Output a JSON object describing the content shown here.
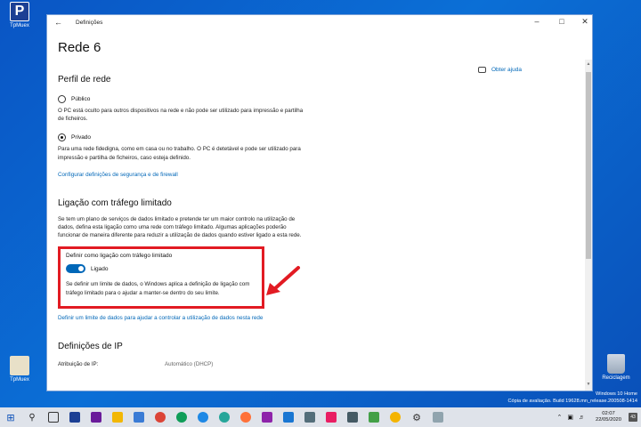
{
  "desktop": {
    "icons": [
      {
        "label": "TpMuex"
      },
      {
        "label": "TpMuex"
      },
      {
        "label": "Reciclagem"
      }
    ]
  },
  "window": {
    "title": "Definições",
    "back_icon": "arrow-left-icon",
    "page_title": "Rede 6",
    "help_link": "Obter ajuda",
    "network_profile": {
      "title": "Perfil de rede",
      "public_label": "Público",
      "public_desc": "O PC está oculto para outros dispositivos na rede e não pode ser utilizado para impressão e partilha de ficheiros.",
      "private_label": "Privado",
      "private_desc": "Para uma rede fidedigna, como em casa ou no trabalho. O PC é detetável e pode ser utilizado para impressão e partilha de ficheiros, caso esteja definido.",
      "selected": "Privado",
      "firewall_link": "Configurar definições de segurança e de firewall"
    },
    "metered": {
      "title": "Ligação com tráfego limitado",
      "desc": "Se tem um plano de serviços de dados limitado e pretende ter um maior controlo na utilização de dados, defina esta ligação como uma rede com tráfego limitado. Algumas aplicações poderão funcionar de maneira diferente para reduzir a utilização de dados quando estiver ligado a esta rede.",
      "toggle_label": "Definir como ligação com tráfego limitado",
      "toggle_state": "Ligado",
      "toggle_desc": "Se definir um limite de dados, o Windows aplica a definição de ligação com tráfego limitado para o ajudar a manter-se dentro do seu limite.",
      "data_limit_link": "Definir um limite de dados para ajudar a controlar a utilização de dados nesta rede"
    },
    "ip": {
      "title": "Definições de IP",
      "assignment_label": "Atribuição de IP:",
      "assignment_value": "Automático (DHCP)"
    }
  },
  "watermark": {
    "line1": "Windows 10 Home",
    "line2": "Cópia de avaliação. Build 19628.mn_release.200508-1414"
  },
  "taskbar": {
    "clock_time": "02:07",
    "clock_date": "22/05/2020",
    "notification_count": "43",
    "colors": {
      "accent": "#0067b8",
      "highlight": "#e21b23"
    }
  }
}
